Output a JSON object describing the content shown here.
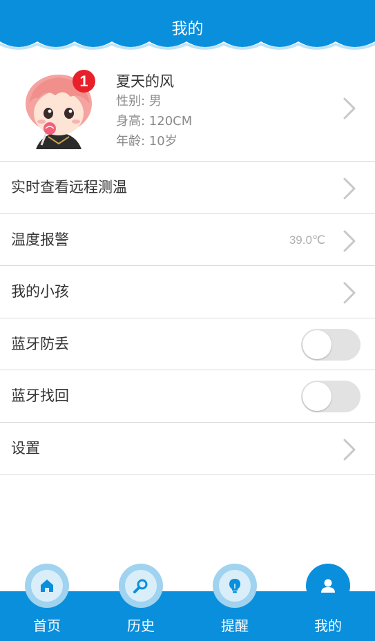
{
  "header": {
    "title": "我的"
  },
  "profile": {
    "name": "夏天的风",
    "gender": "性别: 男",
    "height": "身高: 120CM",
    "age": "年龄: 10岁",
    "badge": "1"
  },
  "menu": {
    "items": [
      {
        "label": "实时查看远程测温",
        "type": "link"
      },
      {
        "label": "温度报警",
        "type": "link",
        "value": "39.0℃"
      },
      {
        "label": "我的小孩",
        "type": "link"
      },
      {
        "label": "蓝牙防丢",
        "type": "toggle",
        "on": false
      },
      {
        "label": "蓝牙找回",
        "type": "toggle",
        "on": false
      },
      {
        "label": "设置",
        "type": "link"
      }
    ]
  },
  "tabs": [
    {
      "label": "首页",
      "icon": "home-icon"
    },
    {
      "label": "历史",
      "icon": "search-icon"
    },
    {
      "label": "提醒",
      "icon": "lightbulb-icon"
    },
    {
      "label": "我的",
      "icon": "user-icon",
      "active": true
    }
  ],
  "colors": {
    "primary": "#0a8fdc",
    "badge": "#e8202a",
    "divider": "#dcdcdc"
  }
}
